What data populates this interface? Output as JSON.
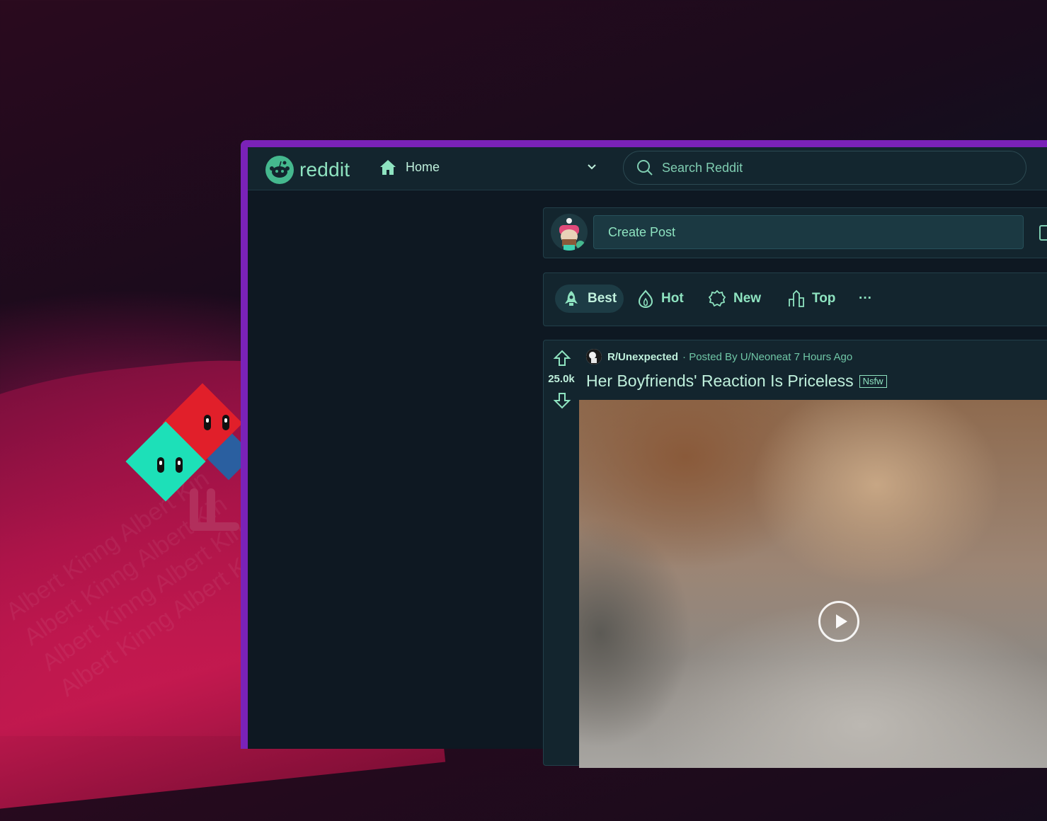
{
  "header": {
    "logo_text": "reddit",
    "home_label": "Home",
    "search_placeholder": "Search Reddit"
  },
  "create_post": {
    "placeholder": "Create Post"
  },
  "sort": {
    "items": [
      {
        "label": "Best",
        "icon": "rocket-icon",
        "active": true
      },
      {
        "label": "Hot",
        "icon": "flame-icon"
      },
      {
        "label": "New",
        "icon": "badge-icon"
      },
      {
        "label": "Top",
        "icon": "bar-chart-icon"
      }
    ],
    "more_label": "···"
  },
  "post": {
    "subreddit": "R/Unexpected",
    "posted_by": "· Posted By U/Neoneat 7 Hours Ago",
    "title": "Her Boyfriends' Reaction Is Priceless",
    "flair": "Nsfw",
    "votes": "25.0k"
  },
  "background": {
    "watermark_text": "Albert Kinng Albert Kinng Albert Kinng"
  },
  "colors": {
    "accent": "#8ee3c0",
    "window_border": "#7a22b8",
    "surface": "#13252e"
  }
}
